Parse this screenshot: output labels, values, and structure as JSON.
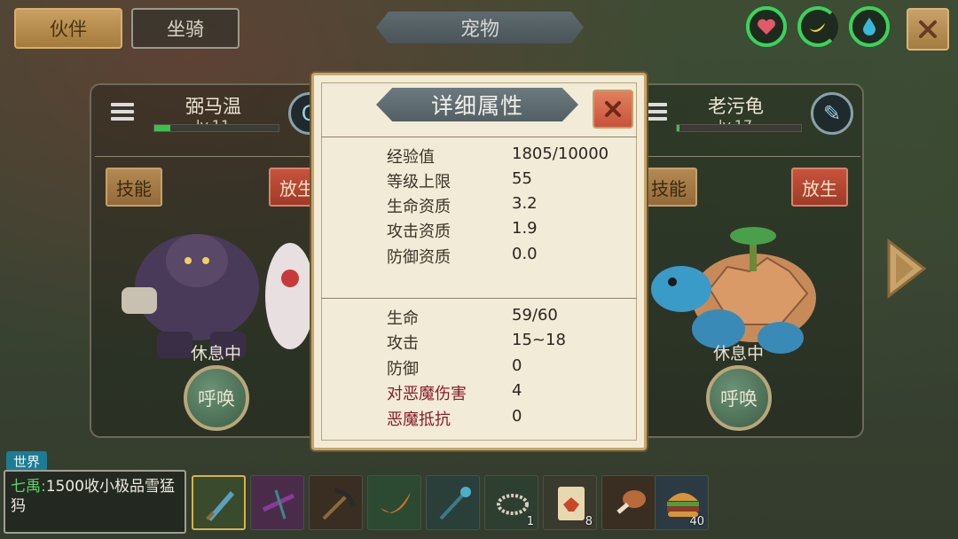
{
  "top_bar": {
    "tab_partner": "伙伴",
    "tab_mount": "坐骑",
    "title": "宠物",
    "status_icons": [
      "heart-icon",
      "banana-icon",
      "water-drop-icon"
    ],
    "close_icon": "close-icon"
  },
  "pets": [
    {
      "name": "弼马温",
      "level": "lv.11",
      "level_progress": 0.13,
      "skill_label": "技能",
      "release_label": "放生",
      "status": "休息中",
      "summon_label": "呼唤"
    },
    {
      "name": "老污龟",
      "level": "lv.17",
      "level_progress": 0.02,
      "skill_label": "技能",
      "release_label": "放生",
      "status": "休息中",
      "summon_label": "呼唤"
    }
  ],
  "dialog": {
    "title": "详细属性",
    "growth": [
      {
        "label": "经验值",
        "value": "1805/10000"
      },
      {
        "label": "等级上限",
        "value": "55"
      },
      {
        "label": "生命资质",
        "value": "3.2"
      },
      {
        "label": "攻击资质",
        "value": "1.9"
      },
      {
        "label": "防御资质",
        "value": "0.0"
      }
    ],
    "combat": [
      {
        "label": "生命",
        "value": "59/60"
      },
      {
        "label": "攻击",
        "value": "15~18"
      },
      {
        "label": "防御",
        "value": "0"
      },
      {
        "label": "对恶魔伤害",
        "value": "4"
      },
      {
        "label": "恶魔抵抗",
        "value": "0"
      }
    ]
  },
  "chat": {
    "channel": "世界",
    "sender": "七禹",
    "separator": ":",
    "message": "1500收小极品雪猛犸"
  },
  "hotbar": {
    "slots": [
      {
        "icon": "crystal-sword-icon",
        "count": ""
      },
      {
        "icon": "purple-crossbow-icon",
        "count": ""
      },
      {
        "icon": "pickaxe-icon",
        "count": ""
      },
      {
        "icon": "horn-icon",
        "count": ""
      },
      {
        "icon": "staff-icon",
        "count": ""
      },
      {
        "icon": "thorn-ring-icon",
        "count": "1"
      },
      {
        "icon": "seed-bag-icon",
        "count": "8"
      },
      {
        "icon": "meat-leg-icon",
        "count": ""
      },
      {
        "icon": "burger-icon",
        "count": "40"
      }
    ]
  },
  "colors": {
    "accent_green": "#39d35a",
    "demon_text": "#8b1a2a",
    "dialog_bg": "#f2ebd7"
  }
}
